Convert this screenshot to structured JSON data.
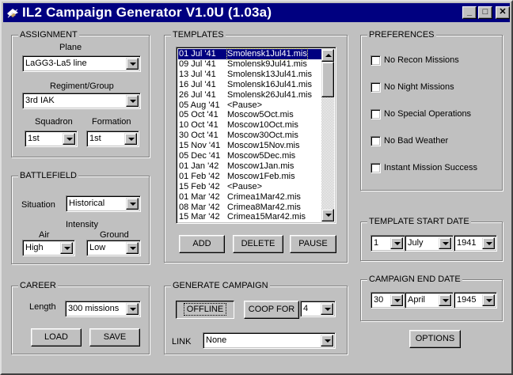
{
  "window": {
    "title": "IL2 Campaign Generator V1.0U (1.03a)",
    "minimize": "_",
    "maximize": "□",
    "close": "✕"
  },
  "assignment": {
    "title": "ASSIGNMENT",
    "plane_label": "Plane",
    "plane_value": "LaGG3-La5 line",
    "regiment_label": "Regiment/Group",
    "regiment_value": "3rd IAK",
    "squadron_label": "Squadron",
    "squadron_value": "1st",
    "formation_label": "Formation",
    "formation_value": "1st"
  },
  "battlefield": {
    "title": "BATTLEFIELD",
    "situation_label": "Situation",
    "situation_value": "Historical",
    "intensity_label": "Intensity",
    "air_label": "Air",
    "air_value": "High",
    "ground_label": "Ground",
    "ground_value": "Low"
  },
  "career": {
    "title": "CAREER",
    "length_label": "Length",
    "length_value": "300 missions",
    "load_label": "LOAD",
    "save_label": "SAVE"
  },
  "templates": {
    "title": "TEMPLATES",
    "rows": [
      {
        "date": "01 Jul '41",
        "mission": "Smolensk1Jul41.mis"
      },
      {
        "date": "09 Jul '41",
        "mission": "Smolensk9Jul41.mis"
      },
      {
        "date": "13 Jul '41",
        "mission": "Smolensk13Jul41.mis"
      },
      {
        "date": "16 Jul '41",
        "mission": "Smolensk16Jul41.mis"
      },
      {
        "date": "26 Jul '41",
        "mission": "Smolensk26Jul41.mis"
      },
      {
        "date": "05 Aug '41",
        "mission": "<Pause>"
      },
      {
        "date": "05 Oct '41",
        "mission": "Moscow5Oct.mis"
      },
      {
        "date": "10 Oct '41",
        "mission": "Moscow10Oct.mis"
      },
      {
        "date": "30 Oct '41",
        "mission": "Moscow30Oct.mis"
      },
      {
        "date": "15 Nov '41",
        "mission": "Moscow15Nov.mis"
      },
      {
        "date": "05 Dec '41",
        "mission": "Moscow5Dec.mis"
      },
      {
        "date": "01 Jan '42",
        "mission": "Moscow1Jan.mis"
      },
      {
        "date": "01 Feb '42",
        "mission": "Moscow1Feb.mis"
      },
      {
        "date": "15 Feb '42",
        "mission": "<Pause>"
      },
      {
        "date": "01 Mar '42",
        "mission": "Crimea1Mar42.mis"
      },
      {
        "date": "08 Mar '42",
        "mission": "Crimea8Mar42.mis"
      },
      {
        "date": "15 Mar '42",
        "mission": "Crimea15Mar42.mis"
      }
    ],
    "add_label": "ADD",
    "delete_label": "DELETE",
    "pause_label": "PAUSE"
  },
  "generate": {
    "title": "GENERATE CAMPAIGN",
    "offline_label": "OFFLINE",
    "coop_label": "COOP FOR",
    "coop_value": "4",
    "link_label": "LINK",
    "link_value": "None"
  },
  "preferences": {
    "title": "PREFERENCES",
    "no_recon": "No Recon Missions",
    "no_night": "No Night Missions",
    "no_special": "No Special Operations",
    "no_bad_weather": "No Bad Weather",
    "instant_success": "Instant Mission Success"
  },
  "template_start": {
    "title": "TEMPLATE START DATE",
    "day": "1",
    "month": "July",
    "year": "1941"
  },
  "campaign_end": {
    "title": "CAMPAIGN END DATE",
    "day": "30",
    "month": "April",
    "year": "1945"
  },
  "options_label": "OPTIONS"
}
